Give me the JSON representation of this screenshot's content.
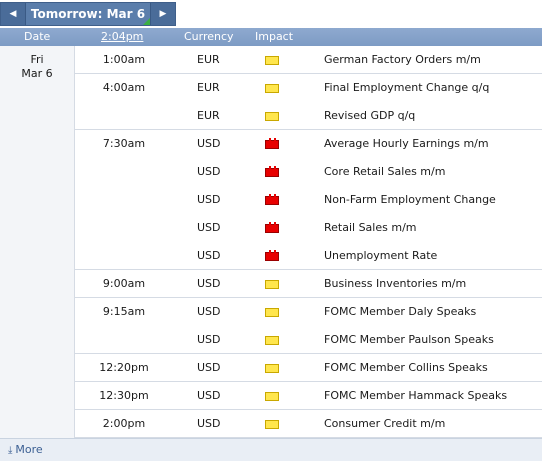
{
  "nav": {
    "title": "Tomorrow: Mar 6",
    "prev_icon": "◀",
    "next_icon": "▶"
  },
  "header": {
    "date": "Date",
    "time": "2:04pm",
    "currency": "Currency",
    "impact": "Impact"
  },
  "date_cell": {
    "day": "Fri",
    "date": "Mar 6"
  },
  "colors": {
    "high": "#e80000",
    "low": "#ffe64d",
    "header": "#8ea9cf"
  },
  "rows": [
    {
      "time": "1:00am",
      "currency": "EUR",
      "impact": "low",
      "event": "German Factory Orders m/m"
    },
    {
      "time": "4:00am",
      "currency": "EUR",
      "impact": "low",
      "event": "Final Employment Change q/q"
    },
    {
      "time": "",
      "currency": "EUR",
      "impact": "low",
      "event": "Revised GDP q/q"
    },
    {
      "time": "7:30am",
      "currency": "USD",
      "impact": "high",
      "event": "Average Hourly Earnings m/m"
    },
    {
      "time": "",
      "currency": "USD",
      "impact": "high",
      "event": "Core Retail Sales m/m"
    },
    {
      "time": "",
      "currency": "USD",
      "impact": "high",
      "event": "Non-Farm Employment Change"
    },
    {
      "time": "",
      "currency": "USD",
      "impact": "high",
      "event": "Retail Sales m/m"
    },
    {
      "time": "",
      "currency": "USD",
      "impact": "high",
      "event": "Unemployment Rate"
    },
    {
      "time": "9:00am",
      "currency": "USD",
      "impact": "low",
      "event": "Business Inventories m/m"
    },
    {
      "time": "9:15am",
      "currency": "USD",
      "impact": "low",
      "event": "FOMC Member Daly Speaks"
    },
    {
      "time": "",
      "currency": "USD",
      "impact": "low",
      "event": "FOMC Member Paulson Speaks"
    },
    {
      "time": "12:20pm",
      "currency": "USD",
      "impact": "low",
      "event": "FOMC Member Collins Speaks"
    },
    {
      "time": "12:30pm",
      "currency": "USD",
      "impact": "low",
      "event": "FOMC Member Hammack Speaks"
    },
    {
      "time": "2:00pm",
      "currency": "USD",
      "impact": "low",
      "event": "Consumer Credit m/m"
    }
  ],
  "footer": {
    "more_label": "More",
    "more_icon": "⤓"
  }
}
